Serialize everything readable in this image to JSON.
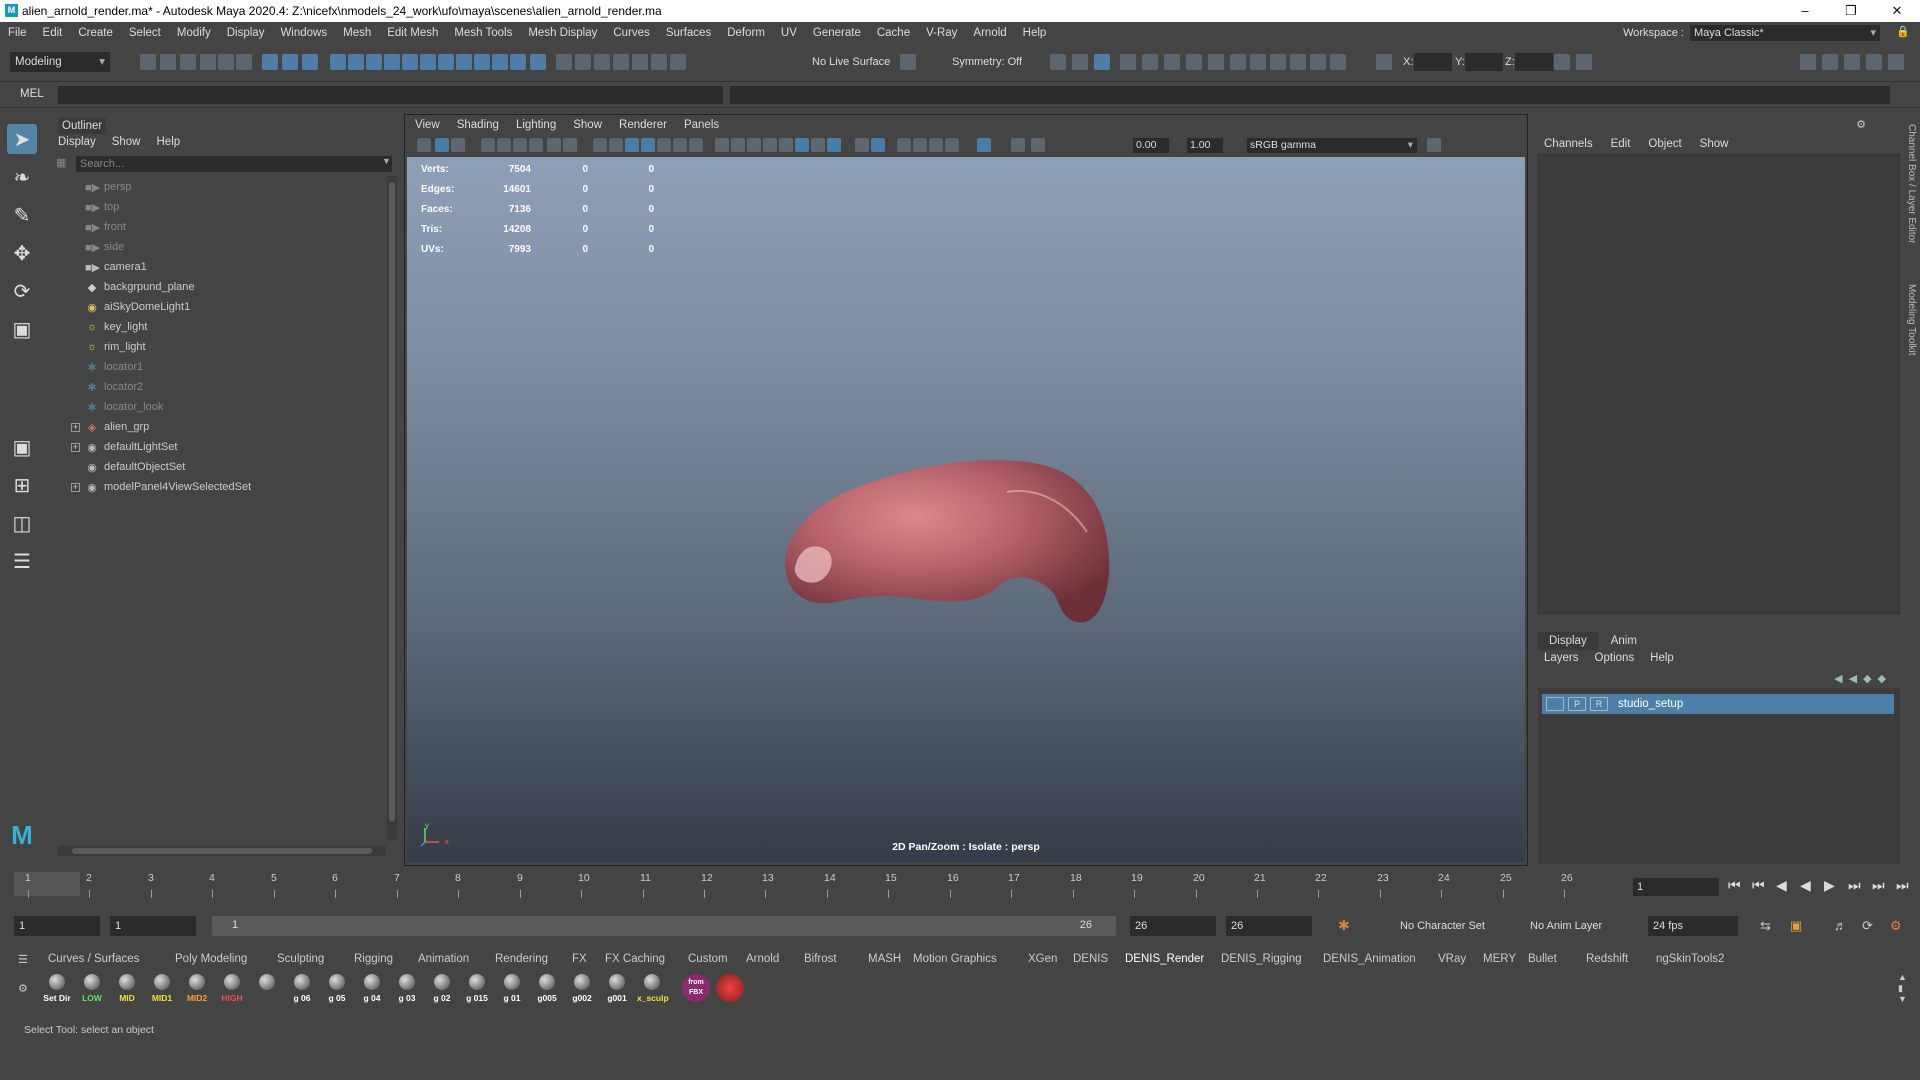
{
  "window": {
    "title": "alien_arnold_render.ma* - Autodesk Maya 2020.4: Z:\\nicefx\\nmodels_24_work\\ufo\\maya\\scenes\\alien_arnold_render.ma",
    "app_icon": "M"
  },
  "menubar": {
    "items": [
      "File",
      "Edit",
      "Create",
      "Select",
      "Modify",
      "Display",
      "Windows",
      "Mesh",
      "Edit Mesh",
      "Mesh Tools",
      "Mesh Display",
      "Curves",
      "Surfaces",
      "Deform",
      "UV",
      "Generate",
      "Cache",
      "V-Ray",
      "Arnold",
      "Help"
    ],
    "workspace_label": "Workspace :",
    "workspace_value": "Maya Classic*"
  },
  "statusline": {
    "mode": "Modeling",
    "live_surface": "No Live Surface",
    "symmetry": "Symmetry: Off",
    "x_label": "X:",
    "y_label": "Y:",
    "z_label": "Z:"
  },
  "cmdline": {
    "label": "MEL"
  },
  "outliner": {
    "tab": "Outliner",
    "menu": [
      "Display",
      "Show",
      "Help"
    ],
    "search_placeholder": "Search...",
    "items": [
      {
        "label": "persp",
        "icon": "camera-icon",
        "dim": true
      },
      {
        "label": "top",
        "icon": "camera-icon",
        "dim": true
      },
      {
        "label": "front",
        "icon": "camera-icon",
        "dim": true
      },
      {
        "label": "side",
        "icon": "camera-icon",
        "dim": true
      },
      {
        "label": "camera1",
        "icon": "camera-icon",
        "dim": false
      },
      {
        "label": "backgrpund_plane",
        "icon": "mesh-icon",
        "dim": false
      },
      {
        "label": "aiSkyDomeLight1",
        "icon": "skydome-icon",
        "dim": false
      },
      {
        "label": "key_light",
        "icon": "light-icon",
        "dim": false
      },
      {
        "label": "rim_light",
        "icon": "light-icon",
        "dim": false
      },
      {
        "label": "locator1",
        "icon": "locator-icon",
        "dim": true
      },
      {
        "label": "locator2",
        "icon": "locator-icon",
        "dim": true
      },
      {
        "label": "locator_look",
        "icon": "locator-icon",
        "dim": true
      },
      {
        "label": "alien_grp",
        "icon": "group-icon",
        "dim": false,
        "expandable": true
      },
      {
        "label": "defaultLightSet",
        "icon": "set-icon",
        "dim": false,
        "expandable": true
      },
      {
        "label": "defaultObjectSet",
        "icon": "set-icon",
        "dim": false
      },
      {
        "label": "modelPanel4ViewSelectedSet",
        "icon": "set-icon",
        "dim": false,
        "expandable": true
      }
    ]
  },
  "viewport": {
    "menu": [
      "View",
      "Shading",
      "Lighting",
      "Show",
      "Renderer",
      "Panels"
    ],
    "exposure": "0.00",
    "gamma": "1.00",
    "color_space": "sRGB gamma",
    "hud": [
      {
        "label": "Verts:",
        "v1": "7504",
        "v2": "0",
        "v3": "0"
      },
      {
        "label": "Edges:",
        "v1": "14601",
        "v2": "0",
        "v3": "0"
      },
      {
        "label": "Faces:",
        "v1": "7136",
        "v2": "0",
        "v3": "0"
      },
      {
        "label": "Tris:",
        "v1": "14208",
        "v2": "0",
        "v3": "0"
      },
      {
        "label": "UVs:",
        "v1": "7993",
        "v2": "0",
        "v3": "0"
      }
    ],
    "caption": "2D Pan/Zoom : Isolate : persp",
    "axis_y": "y",
    "axis_x": "x"
  },
  "channelbox": {
    "menu": [
      "Channels",
      "Edit",
      "Object",
      "Show"
    ],
    "side_label_1": "Channel Box / Layer Editor",
    "side_label_2": "Modeling Toolkit"
  },
  "layer_editor": {
    "tabs": [
      "Display",
      "Anim"
    ],
    "menu": [
      "Layers",
      "Options",
      "Help"
    ],
    "layer": {
      "v": "",
      "p": "P",
      "r": "R",
      "name": "studio_setup"
    }
  },
  "timeslider": {
    "ticks": [
      "1",
      "2",
      "3",
      "4",
      "5",
      "6",
      "7",
      "8",
      "9",
      "10",
      "11",
      "12",
      "13",
      "14",
      "15",
      "16",
      "17",
      "18",
      "19",
      "20",
      "21",
      "22",
      "23",
      "24",
      "25",
      "26"
    ],
    "current_frame": "1"
  },
  "rangeslider": {
    "start": "1",
    "playback_start": "1",
    "bar_start": "1",
    "bar_end": "26",
    "playback_end": "26",
    "end": "26",
    "character_set": "No Character Set",
    "anim_layer": "No Anim Layer",
    "fps": "24 fps"
  },
  "shelf": {
    "tabs": [
      "Curves / Surfaces",
      "Poly Modeling",
      "Sculpting",
      "Rigging",
      "Animation",
      "Rendering",
      "FX",
      "FX Caching",
      "Custom",
      "Arnold",
      "Bifrost",
      "MASH",
      "Motion Graphics",
      "XGen",
      "DENIS",
      "DENIS_Render",
      "DENIS_Rigging",
      "DENIS_Animation",
      "VRay",
      "MERY",
      "Bullet",
      "Redshift",
      "ngSkinTools2"
    ],
    "active_tab": "DENIS_Render",
    "buttons": [
      {
        "label": "Set Dir",
        "color": "#ffffff"
      },
      {
        "label": "LOW",
        "color": "#5fe05f"
      },
      {
        "label": "MID",
        "color": "#f0e040"
      },
      {
        "label": "MID1",
        "color": "#f0e040"
      },
      {
        "label": "MID2",
        "color": "#f0a040"
      },
      {
        "label": "HIGH",
        "color": "#f05050"
      },
      {
        "label": "",
        "color": "#ffffff"
      },
      {
        "label": "g 06",
        "color": "#ffffff"
      },
      {
        "label": "g 05",
        "color": "#ffffff"
      },
      {
        "label": "g 04",
        "color": "#ffffff"
      },
      {
        "label": "g 03",
        "color": "#ffffff"
      },
      {
        "label": "g 02",
        "color": "#ffffff"
      },
      {
        "label": "g 015",
        "color": "#ffffff"
      },
      {
        "label": "g 01",
        "color": "#ffffff"
      },
      {
        "label": "g005",
        "color": "#ffffff"
      },
      {
        "label": "g002",
        "color": "#ffffff"
      },
      {
        "label": "g001",
        "color": "#ffffff"
      },
      {
        "label": "x_sculp",
        "color": "#f0e040"
      }
    ],
    "fbx_label": "from FBX"
  },
  "helpline": {
    "text": "Select Tool: select an object"
  },
  "colors": {
    "accent": "#4e7fa8",
    "panel": "#444444",
    "field": "#2b2b2b"
  }
}
